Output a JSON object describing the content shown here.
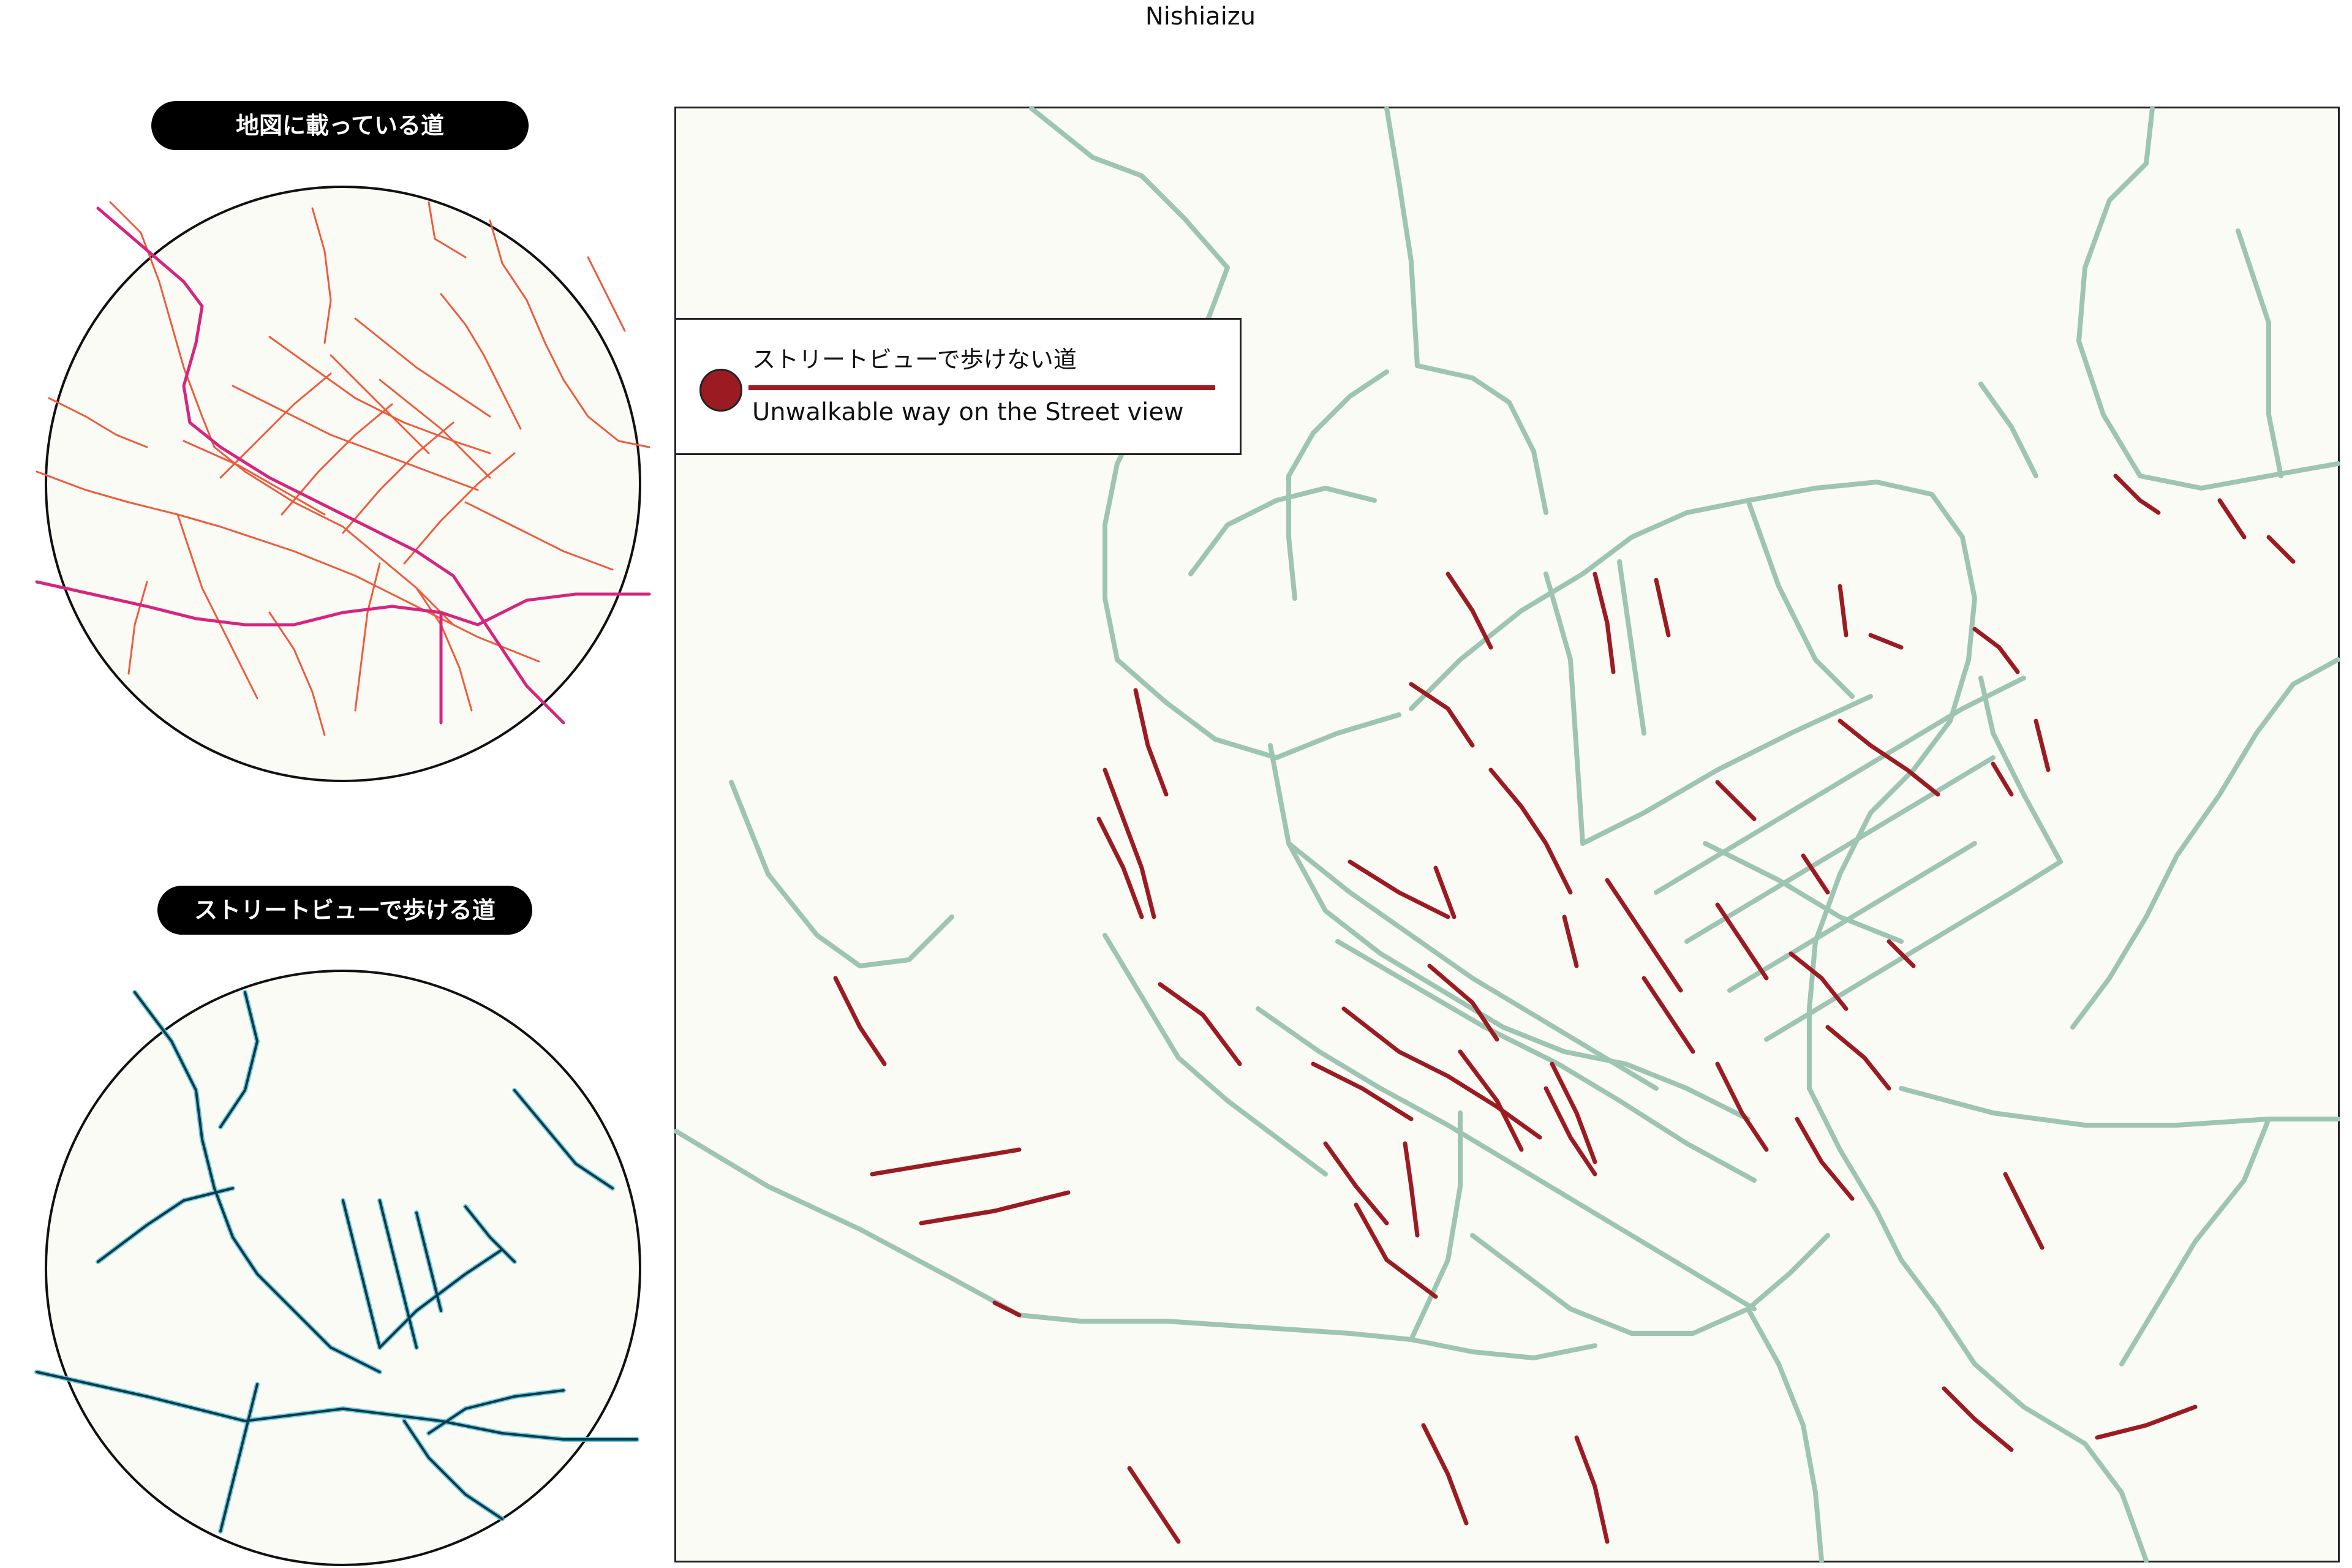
{
  "title": "Nishiaizu",
  "panels": {
    "map_roads_label": "地図に載っている道",
    "walkable_label": "ストリートビューで歩ける道"
  },
  "legend": {
    "jp": "ストリートビューで歩けない道",
    "en": "Unwalkable way on the Street view"
  },
  "colors": {
    "unwalkable": "#9c1b22",
    "walkable": "#9ec4b3",
    "map_road": "#ef5a3c",
    "major_road": "#d6247f",
    "walkable_dark": "#14394a",
    "walkable_glow": "#4fc6de",
    "background": "#fbfbf5"
  }
}
